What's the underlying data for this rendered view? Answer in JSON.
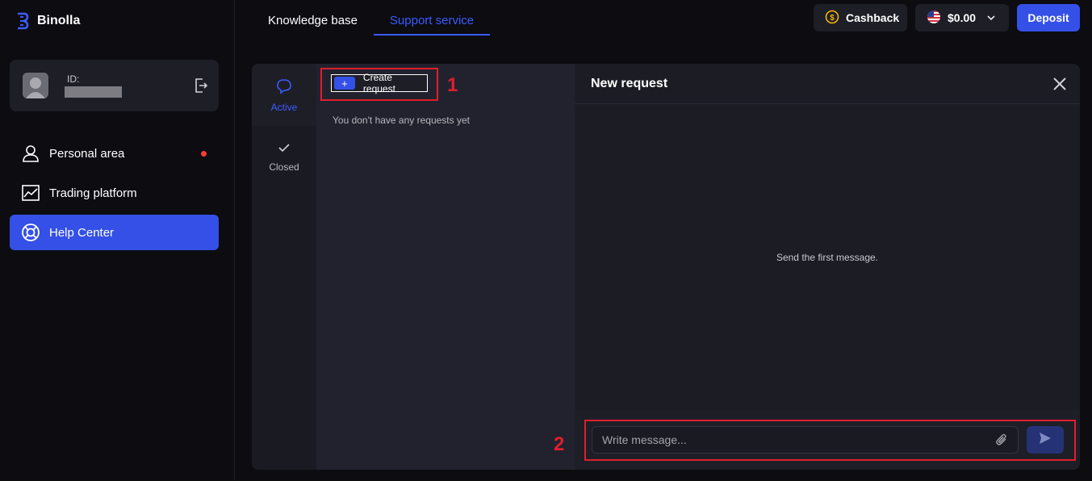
{
  "brand": {
    "name": "Binolla"
  },
  "profile": {
    "id_label": "ID:"
  },
  "nav": {
    "items": [
      {
        "label": "Personal area",
        "icon": "user-icon",
        "has_notification": true
      },
      {
        "label": "Trading platform",
        "icon": "chart-icon",
        "has_notification": false
      },
      {
        "label": "Help Center",
        "icon": "lifebuoy-icon",
        "active": true
      }
    ]
  },
  "tabs": [
    {
      "label": "Knowledge base",
      "active": false
    },
    {
      "label": "Support service",
      "active": true
    }
  ],
  "header": {
    "cashback_label": "Cashback",
    "balance": "$0.00",
    "deposit_label": "Deposit"
  },
  "requests": {
    "status_tabs": [
      {
        "label": "Active",
        "icon": "chat-bubble-icon",
        "active": true
      },
      {
        "label": "Closed",
        "icon": "check-icon",
        "active": false
      }
    ],
    "create_button": {
      "icon_label": "+",
      "label": "Create request"
    },
    "empty_text": "You don't have any requests yet"
  },
  "chat": {
    "title": "New request",
    "empty_text": "Send the first message.",
    "input_placeholder": "Write message..."
  },
  "annotations": [
    {
      "number": "1"
    },
    {
      "number": "2"
    }
  ],
  "colors": {
    "accent": "#3450e6",
    "annotation": "#e01e2c",
    "notification": "#ff3b3b"
  }
}
